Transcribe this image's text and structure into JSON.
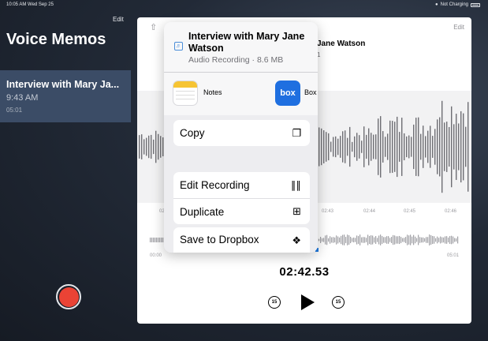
{
  "status_bar": {
    "time": "10:05 AM",
    "date": "Wed Sep 25",
    "charging": "Not Charging"
  },
  "sidebar": {
    "edit_label": "Edit",
    "title": "Voice Memos",
    "memo": {
      "title": "Interview with Mary Ja...",
      "time": "9:43 AM",
      "duration": "05:01"
    }
  },
  "panel": {
    "edit_label": "Edit",
    "title_partial": "Jane Watson",
    "subtitle_partial": "1",
    "timeline_labels": [
      "02",
      "02:43",
      "02:44",
      "02:45",
      "02:46"
    ],
    "overview_start": "00:00",
    "overview_end": "05:01",
    "timer": "02:42.53",
    "skip_back": "15",
    "skip_forward": "15"
  },
  "share_sheet": {
    "title": "Interview with Mary Jane Watson",
    "subtitle": "Audio Recording · 8.6 MB",
    "apps": [
      {
        "label": "Notes",
        "icon": "notes-app-icon"
      },
      {
        "label": "Box",
        "icon_text": "box",
        "icon": "box-app-icon"
      }
    ],
    "actions": {
      "copy": "Copy",
      "edit_recording": "Edit Recording",
      "duplicate": "Duplicate",
      "save_to_dropbox": "Save to Dropbox"
    }
  },
  "colors": {
    "accent": "#1f7ae0",
    "record": "#ea4335",
    "selected_row": "#3b4c66",
    "box_brand": "#1f6fe0"
  }
}
